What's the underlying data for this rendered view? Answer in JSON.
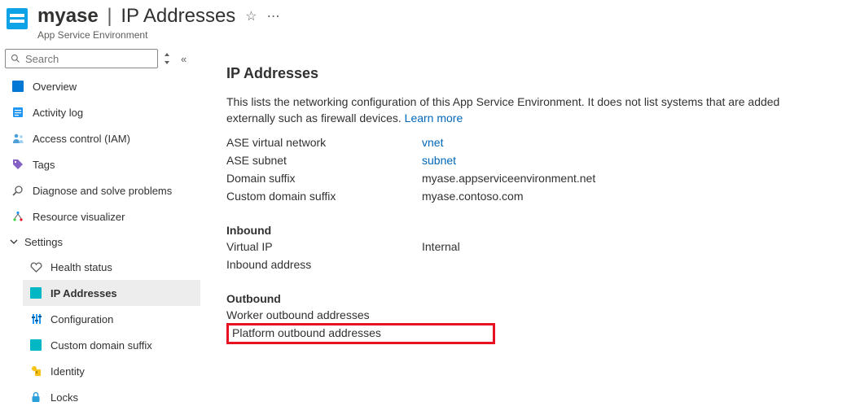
{
  "header": {
    "resource_name": "myase",
    "blade_title": "IP Addresses",
    "resource_type": "App Service Environment",
    "favorite_icon": "☆",
    "more_icon": "⋯"
  },
  "search": {
    "placeholder": "Search"
  },
  "sidebar": {
    "overview": "Overview",
    "activity_log": "Activity log",
    "access_control": "Access control (IAM)",
    "tags": "Tags",
    "diagnose": "Diagnose and solve problems",
    "resource_visualizer": "Resource visualizer",
    "settings_group": "Settings",
    "health_status": "Health status",
    "ip_addresses": "IP Addresses",
    "configuration": "Configuration",
    "custom_domain_suffix": "Custom domain suffix",
    "identity": "Identity",
    "locks": "Locks"
  },
  "main": {
    "title": "IP Addresses",
    "description": "This lists the networking configuration of this App Service Environment. It does not list systems that are added externally such as firewall devices.",
    "learn_more": "Learn more",
    "rows": {
      "ase_vnet_label": "ASE virtual network",
      "ase_vnet_value": "vnet",
      "ase_subnet_label": "ASE subnet",
      "ase_subnet_value": "subnet",
      "domain_suffix_label": "Domain suffix",
      "domain_suffix_value": "myase.appserviceenvironment.net",
      "custom_domain_label": "Custom domain suffix",
      "custom_domain_value": "myase.contoso.com"
    },
    "inbound": {
      "heading": "Inbound",
      "virtual_ip_label": "Virtual IP",
      "virtual_ip_value": "Internal",
      "inbound_address_label": "Inbound address"
    },
    "outbound": {
      "heading": "Outbound",
      "worker_label": "Worker outbound addresses",
      "platform_label": "Platform outbound addresses"
    }
  }
}
